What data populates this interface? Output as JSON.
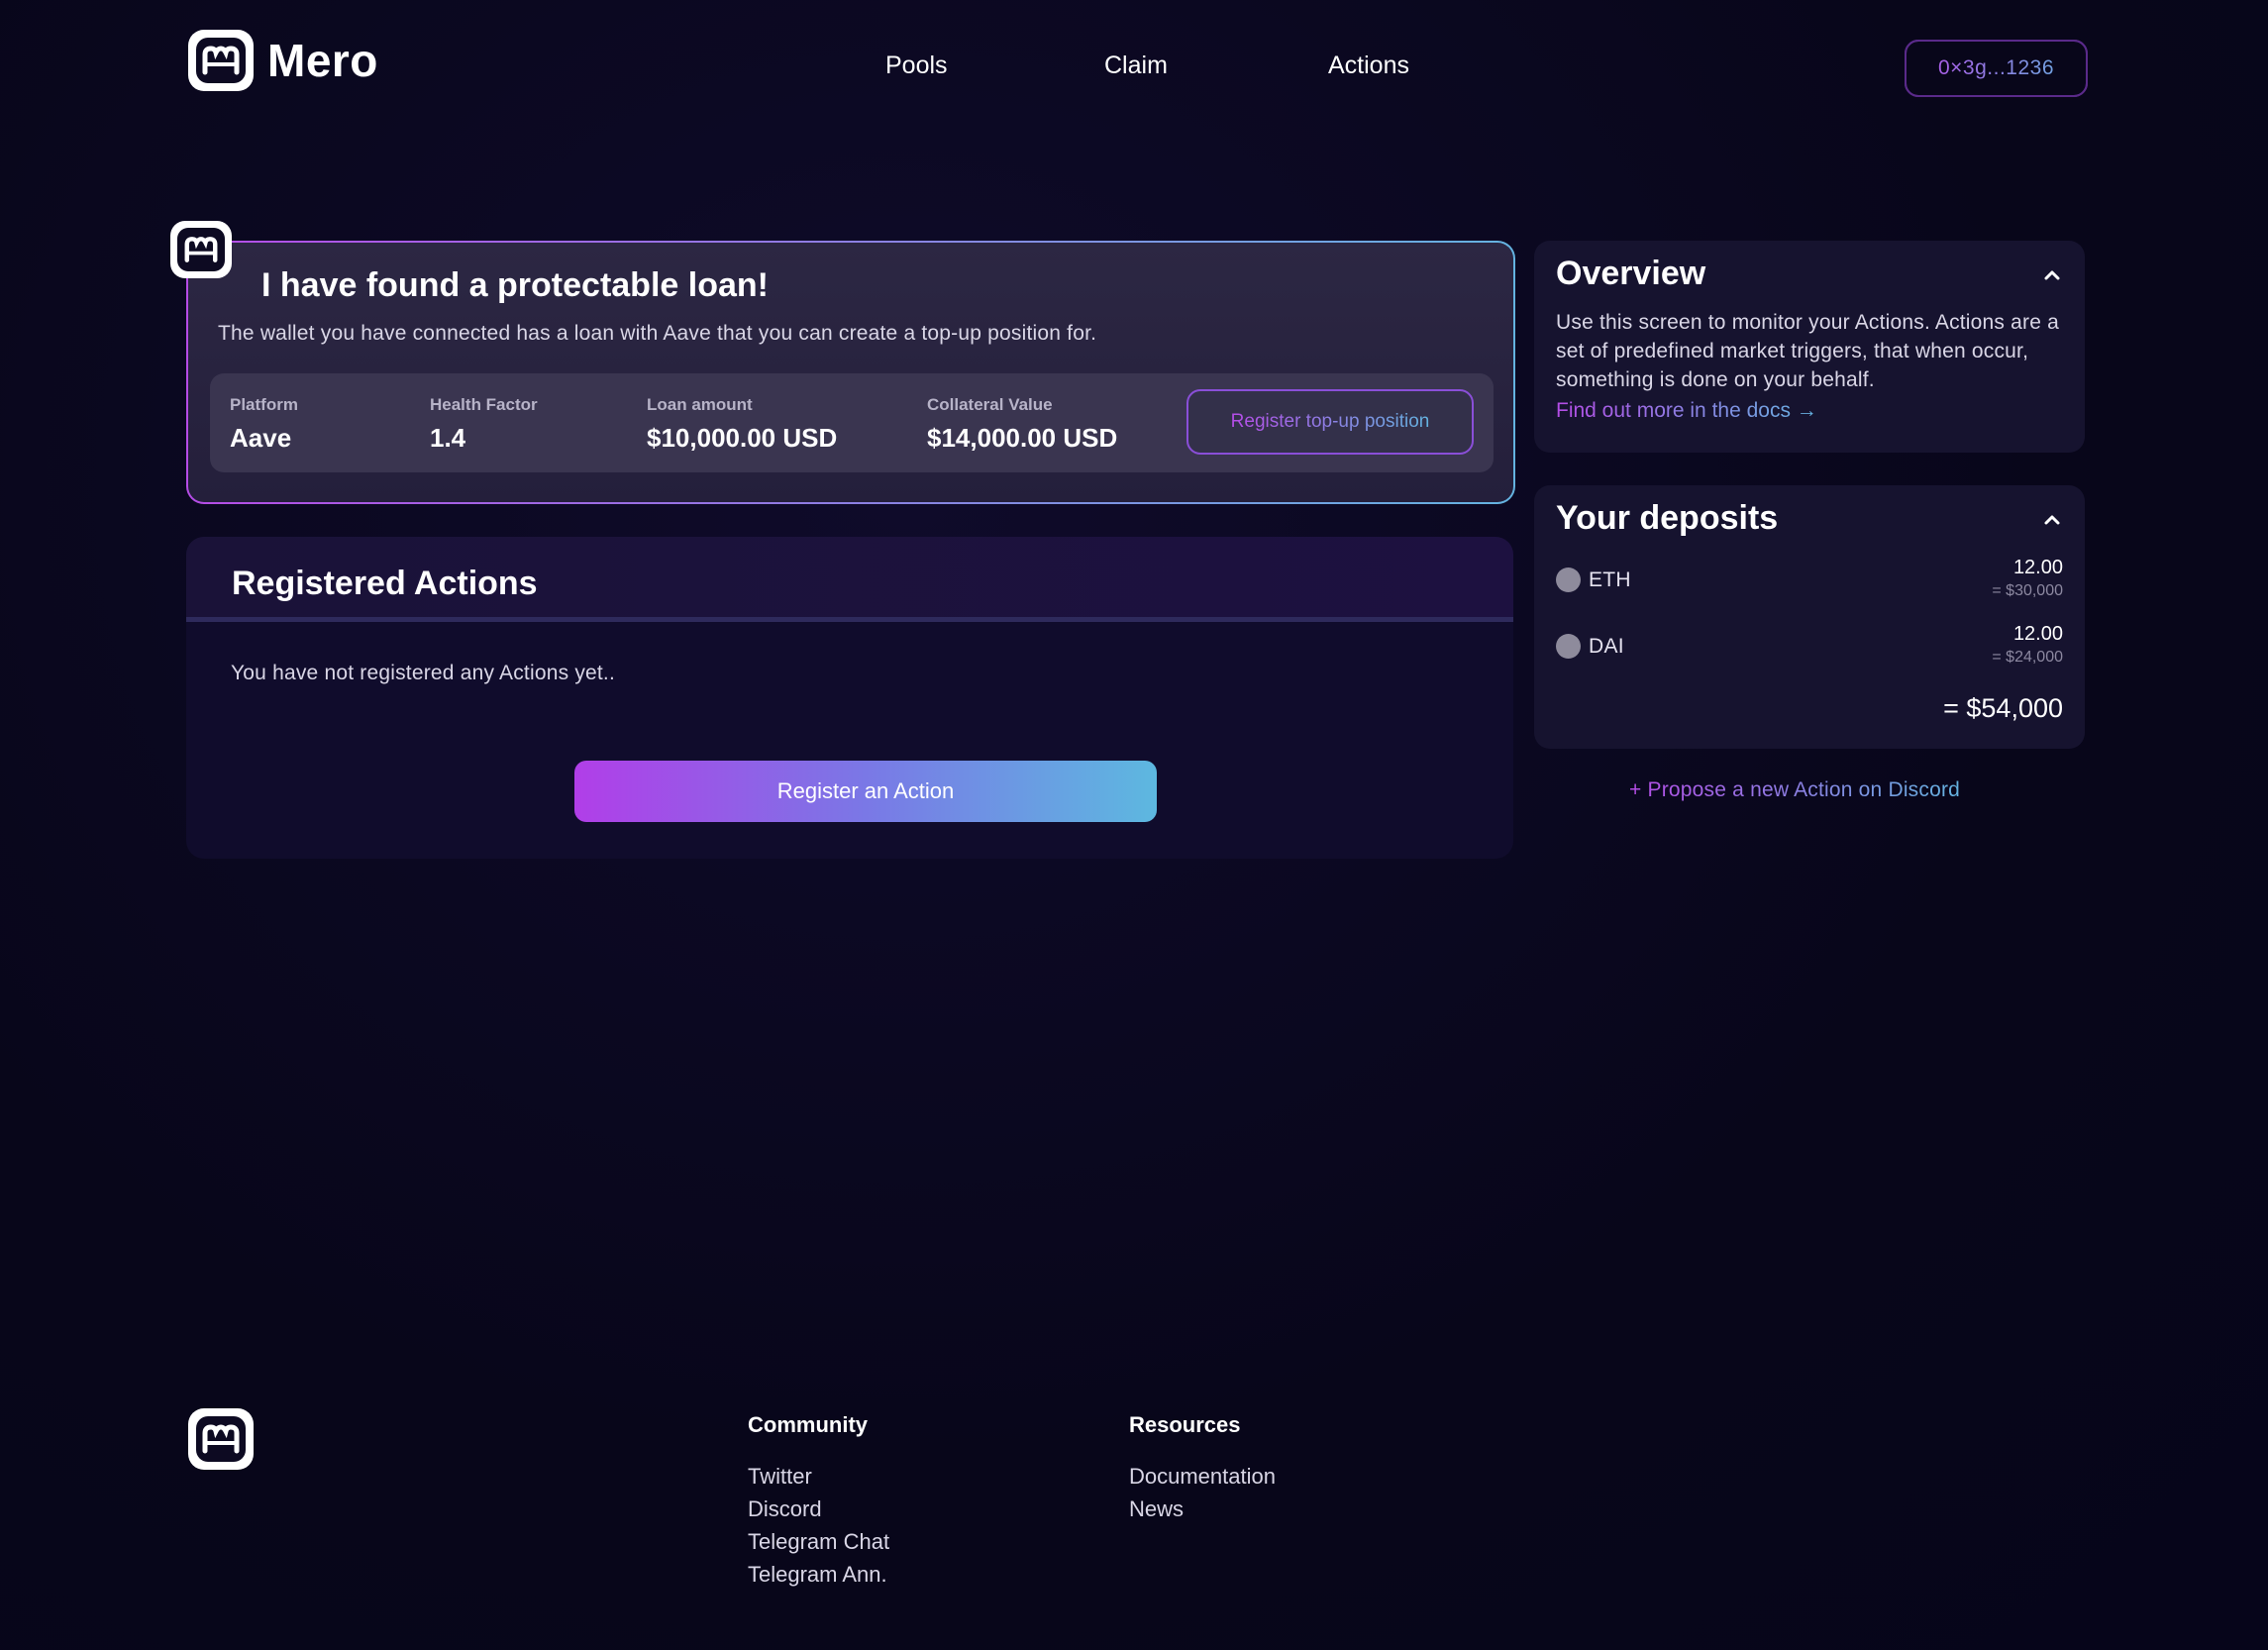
{
  "app": {
    "name": "Mero"
  },
  "nav": {
    "pools": "Pools",
    "claim": "Claim",
    "actions": "Actions"
  },
  "wallet": {
    "address": "0×3g...1236"
  },
  "loan_alert": {
    "title": "I have found a protectable loan!",
    "description": "The wallet you have connected has a loan with Aave that you can create a top-up position for.",
    "stats": {
      "platform_label": "Platform",
      "platform_value": "Aave",
      "health_label": "Health Factor",
      "health_value": "1.4",
      "loan_label": "Loan amount",
      "loan_value": "$10,000.00 USD",
      "collateral_label": "Collateral Value",
      "collateral_value": "$14,000.00 USD"
    },
    "button_label": "Register top-up position"
  },
  "registered_actions": {
    "title": "Registered Actions",
    "empty_message": "You have not registered any Actions yet..",
    "button_label": "Register an Action"
  },
  "overview": {
    "title": "Overview",
    "text": "Use this screen to monitor your Actions. Actions are a set of predefined market triggers, that when occur, something is done on your behalf.",
    "link": "Find out more in the docs →"
  },
  "deposits": {
    "title": "Your deposits",
    "items": [
      {
        "token": "ETH",
        "amount": "12.00",
        "usd": "= $30,000"
      },
      {
        "token": "DAI",
        "amount": "12.00",
        "usd": "= $24,000"
      }
    ],
    "total": "= $54,000"
  },
  "discord_link": "+ Propose a new Action on Discord",
  "footer": {
    "community": {
      "heading": "Community",
      "links": [
        "Twitter",
        "Discord",
        "Telegram Chat",
        "Telegram Ann."
      ]
    },
    "resources": {
      "heading": "Resources",
      "links": [
        "Documentation",
        "News"
      ]
    }
  },
  "colors": {
    "background": "#08061a",
    "accent_start": "#b54ce6",
    "accent_end": "#64b3e0",
    "card": "#16132f"
  },
  "icons": {
    "logo": "mero-logo-icon",
    "collapse": "chevron-up-icon",
    "token": "token-circle-icon"
  }
}
